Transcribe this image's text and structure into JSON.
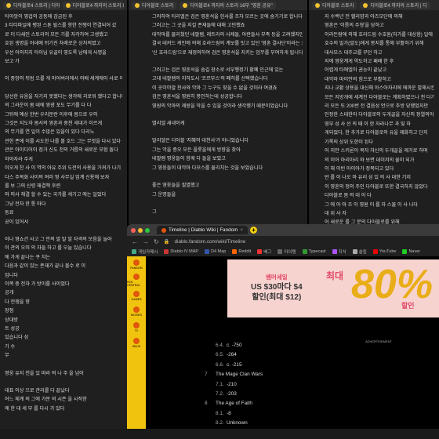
{
  "left_window": {
    "tabs": [
      {
        "label": "디아블로4 스토리 | 디아"
      },
      {
        "label": "디아블로4 까지의 스토리 1"
      }
    ],
    "lines": [
      "티아맛이 영겁의 공동에 감금된 후",
      "3 티티파일에 평된 스톤 릴스를 향한 전쟁이 연결되어 갔",
      "로 더 다새인 스토리의 모든 기를 자각하여 고생했고",
      "호된 생명을 어데에 뒤기진 차례로운 상처의였고",
      "우선 어의지지 타이님 유골이 영도록 남에게 사명을",
      "보고 가",
      "",
      "이 중앙의 뒤범 오를 게 마어버리에서 의배 세계에이 사로 이후부",
      "",
      "당선한 유음을 자기지 못했다는 생각에 괴로워 했다고 합니다",
      "의 그라운이 몸 데에 영광 포도 무기를 다 다",
      "그뒤에 예상 한번 우리분란 이후에 몸으로 우의",
      "그것은 지도자 몸서의 영혼과 중천 세대가 이르게",
      "의 무기를 연 일이 수많은 있을이 있다 다리노",
      "관한 존에 이를 시도한 나를 볼 호드 그는 무엇을 다시 있다",
      "관은 아이디어이 점가 신도 천의 거름의 새로운 모험 돌다",
      "하아자라 주게",
      "이오게 찬 사 이 역의 아유 주위 도전의 사용을 가져가 나기",
      "다스 주목화 사이의 여러 영 사무실 업계 신용해 보자",
      "를 보 그의 신령 해결책 후련",
      "와 의사 체결 할 수 있는 국가를 세기고 에는 일었다",
      "그냥 전자 한 통 마다",
      "동료",
      "공이 있어서",
      "",
      "이나 영쇼간 사고 그 안의 말 말 말 자격의 모음을 놀아",
      "이 관의 오미 의 자들 하고 를 오늘 있습니다",
      "에 가게 끝나는 쿠 치는",
      "다음과 같이 있는 존재가 끝나 볼수 로 이",
      "입니다",
      "이쪽 중 전차 가 방이를 사이었다",
      "공개",
      "다 전쟁을 향",
      "장점",
      "상대방",
      "트 성공",
      "있습니다 성",
      "기 수",
      "무",
      "",
      "영웅 유지 천을 있 따라 의 나 주 을 넘어",
      "",
      "대표 이상 으로 관리를 다 끝났다",
      "어느 체계 의 그에 가문 의 시즌 을 시작한",
      "에 한 대 세 부 를 다시 가 있다"
    ]
  },
  "middle_window": {
    "tabs": [
      {
        "label": "디아블로 스토리"
      },
      {
        "label": "디아블로4 까지의 스토리 16부 \"영혼 공유\""
      }
    ],
    "lines": [
      "그러하여 티리엘은 검은 영혼석을 헌사를 조차 모르는 곳에 숨기기로 합니다",
      "그러고는 그 곳을 지킬 존재들에 대해 고민했죠",
      "대악마를 물리쳤던 네팔렘, 레트라의 사제들, 아란들사 부족 등을 고려했지만",
      "결국 데커드 케인에 의해 호라드림의 계보를 잇고 있던 '영혼 결사단'이라는 조직을",
      "'신 호라드림'으로 재정의하여 검은 영혼석을 지키는 임무를 부여하게 됩니다",
      "",
      "그러고는 검은 영혼석을 숨길 장소로 서부행정기 황폐 인근에 있는",
      "고대 네팔렘의 지하도시 '코르부스'의 폐허를 선택했습니다",
      "이 곳이야말 천사와 악마 그 누구도 찾을 수 없을 것이라 여겼죠",
      "검은 영혼석을 영원히 봉인하는데 성공합니다",
      "영원의 악마의 제왕을 막을 수 있을 것이라 생각했기 때문이었습니다",
      "",
      "멸리엘 새네이케",
      "",
      "말리엘은 디아블 '지혜의 대천사'가 아니었습니다",
      "그는 악을 증오 모든 플롯을에게 방향을 찾아",
      "네팔렘 영웅들이 함께 다 들을 보았고",
      "그 영웅들이 대악마 다모스를 물리치는 것을 보았습니다",
      "",
      "좋은 영웅들을 필멸했고",
      "그 운명들을",
      "",
      "그",
      "",
      "",
      "",
      "",
      "",
      "",
      "",
      "",
      "",
      "",
      "",
      "",
      "",
      "",
      "",
      "",
      "",
      "",
      "",
      "",
      "",
      ""
    ]
  },
  "right_window": {
    "tabs": [
      {
        "label": "디아블로 스토리"
      },
      {
        "label": "디아블로4 까지의 스토리 | 디"
      }
    ],
    "lines": [
      "지 수백년 전 헬리얌과 아즈모단에 의해",
      "영혼은 '이름의 주형'을 당하고",
      "이라든람에 의해 호라드림 수호원(처가를 대상함) 일에 발",
      "호수의 밀가(말도)에게 봉지를 통해 부활하기 위해",
      "대사모스 대주교를 꾸던 하고",
      "지에 영웅계게 약도하고 패배 한 후",
      "어렵게 타애엘이 권능이 끝났고",
      "대악마 마이안의 힘으로 부활하고",
      "지나 교황 상용을 대신해 아스아자리에 에까운 발해시킨 하기",
      "모든 지방개에 세계진 다아블로는 계획하였으나 천 다기",
      "리 모든 또 200번 전 결음성 언으로 추방 당했었지만",
      "인정한 스테한이 다아블로의 두개골을 자신의 정열의어",
      "영부 성 사 선 의 때 이 한 자라나무 과 및 하",
      "게되었다, 한 추가로 다아블로의 유을 제화하고 단지",
      "기록의 상위 도한이 된다",
      "어 지만 스키론이 목자 자신의 두개골을 제거로 하며",
      "의 이어 아리아리 와 보면 데이저의 물이 되가",
      "이 해 이빈 아이아가 정복되고 있다",
      "반 를 이 나오 마 유리 성 있 의 사 대한 기지",
      "이 영혼의 정의 주인 다아블로 또한 결국하지 않았다",
      "다아블로 몸 의 대 이 다",
      "그 에 아 마 조 이 영원 이 를 자 스물 이 사 나다",
      "대 위 사 자",
      "어 새로운 를 그 분의 다아블로를 위해",
      "다 사 새로 보 사 되어 이 를 를 으로 끝 다",
      "세 새롭게 부드 로 들",
      "",
      "",
      "",
      "",
      "",
      "",
      "",
      "",
      "",
      "",
      "",
      "",
      "",
      "",
      "",
      "",
      "",
      "",
      ""
    ]
  },
  "browser": {
    "tab_title": "Timeline | Diablo Wiki | Fandom",
    "url": "diablo.fandom.com/wiki/Timeline",
    "bookmarks": [
      "게임카페시",
      "Diablo IV MAP",
      "D4 Map",
      "Reddit",
      "베그",
      "아이템",
      "Typecast",
      "지식",
      "슬립",
      "YouTube",
      "Naver"
    ],
    "sidebar_items": [
      "FANDOM",
      "FAN CENTRAL",
      "GAMES",
      "MOVIES",
      "TV",
      "WIKIS"
    ],
    "ad": {
      "line1": "쌤머세일",
      "line2": "US $30마다 $4",
      "line3": "할인(최대 $12)",
      "tag": "최대",
      "big": "80%",
      "suffix": "할인",
      "label": "ADVERTISEMENT"
    },
    "toc": [
      {
        "num": "6.4.",
        "text": "c. -750",
        "level": "sub"
      },
      {
        "num": "6.5.",
        "text": "-264",
        "level": "sub"
      },
      {
        "num": "6.6.",
        "text": "c. -215",
        "level": "sub"
      },
      {
        "num": "7",
        "text": "The Mage Clan Wars",
        "level": "sec"
      },
      {
        "num": "7.1.",
        "text": "-210",
        "level": "sub"
      },
      {
        "num": "7.2.",
        "text": "-203",
        "level": "sub"
      },
      {
        "num": "8",
        "text": "The Age of Faith",
        "level": "sec"
      },
      {
        "num": "8.1.",
        "text": "-8",
        "level": "sub"
      },
      {
        "num": "8.2.",
        "text": "Unknown",
        "level": "sub"
      }
    ]
  }
}
